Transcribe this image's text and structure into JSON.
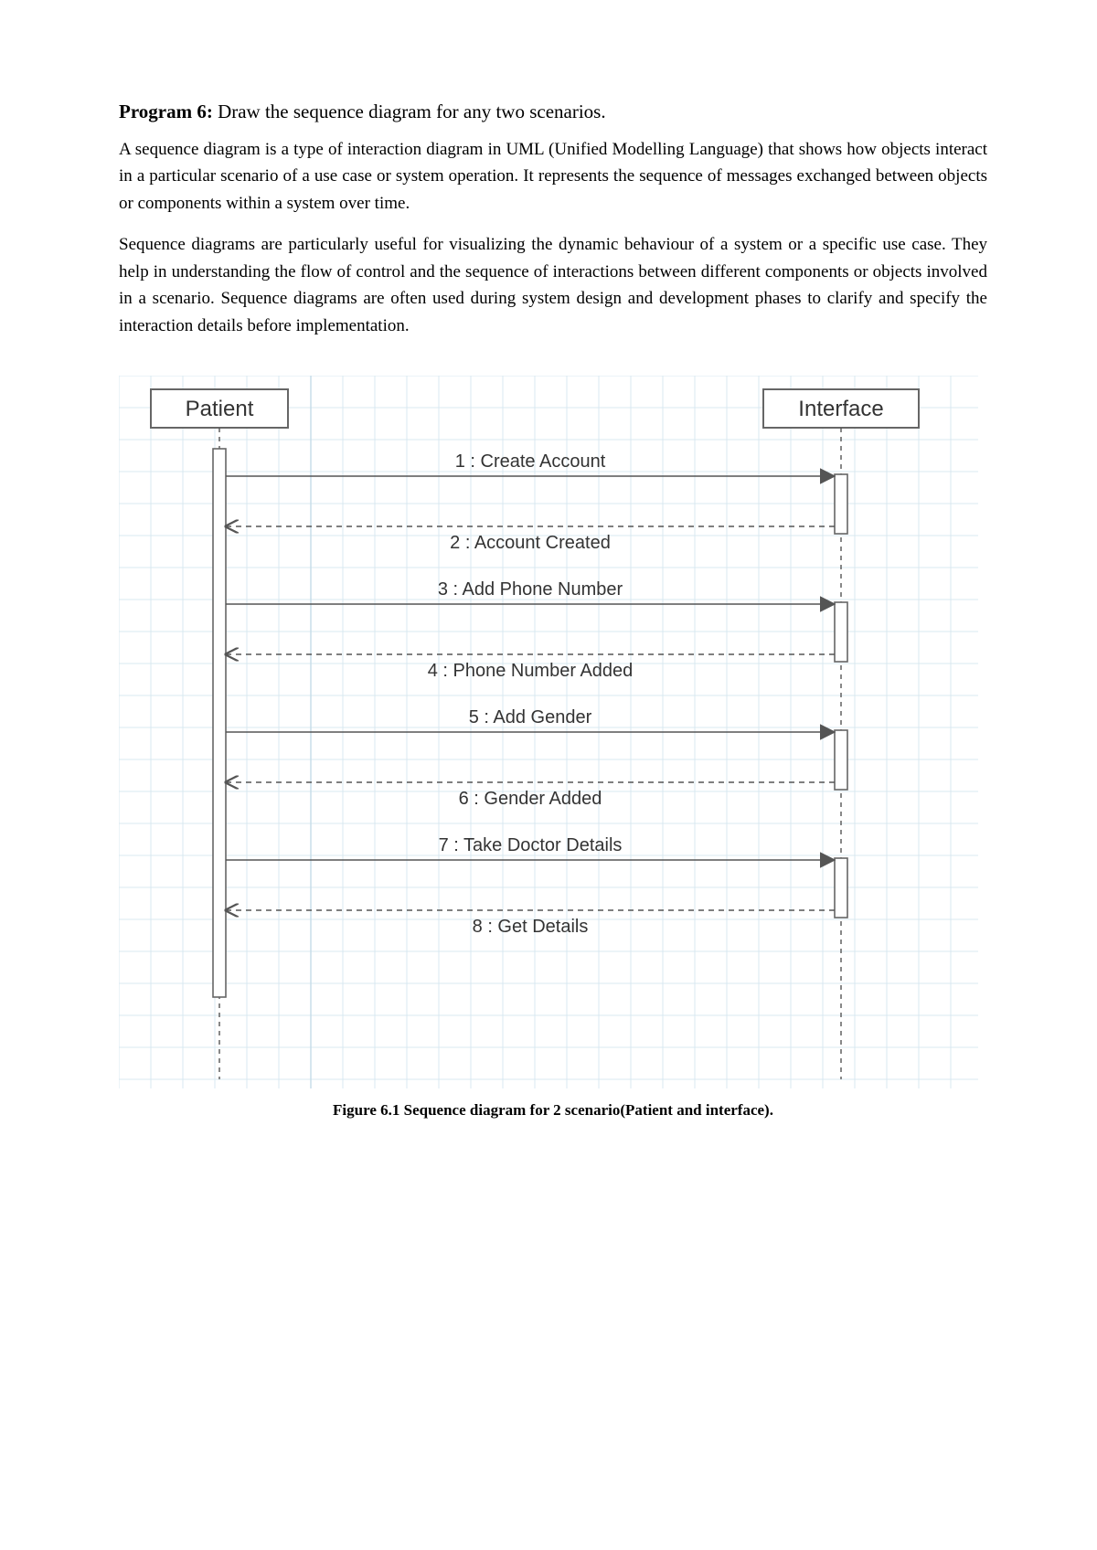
{
  "title": {
    "label": "Program 6:",
    "rest": " Draw the sequence diagram for any two scenarios."
  },
  "paragraphs": [
    "A sequence diagram is a type of interaction diagram in UML (Unified Modelling Language) that shows how objects interact in a particular scenario of a use case or system operation. It represents the sequence of messages exchanged between objects or components within a system over time.",
    "Sequence diagrams are particularly useful for visualizing the dynamic behaviour of a system or a specific use case. They help in understanding the flow of control and the sequence of interactions between different components or objects involved in a scenario. Sequence diagrams are often used during system design and development phases to clarify and specify the interaction details before implementation."
  ],
  "diagram": {
    "lifelines": [
      {
        "name": "Patient"
      },
      {
        "name": "Interface"
      }
    ],
    "messages": [
      {
        "n": 1,
        "text": "Create Account",
        "dir": "call"
      },
      {
        "n": 2,
        "text": "Account Created",
        "dir": "return"
      },
      {
        "n": 3,
        "text": "Add Phone Number",
        "dir": "call"
      },
      {
        "n": 4,
        "text": "Phone Number Added",
        "dir": "return"
      },
      {
        "n": 5,
        "text": "Add Gender",
        "dir": "call"
      },
      {
        "n": 6,
        "text": "Gender Added",
        "dir": "return"
      },
      {
        "n": 7,
        "text": "Take Doctor Details",
        "dir": "call"
      },
      {
        "n": 8,
        "text": "Get Details",
        "dir": "return"
      }
    ]
  },
  "caption": "Figure 6.1 Sequence diagram for 2 scenario(Patient and interface)."
}
